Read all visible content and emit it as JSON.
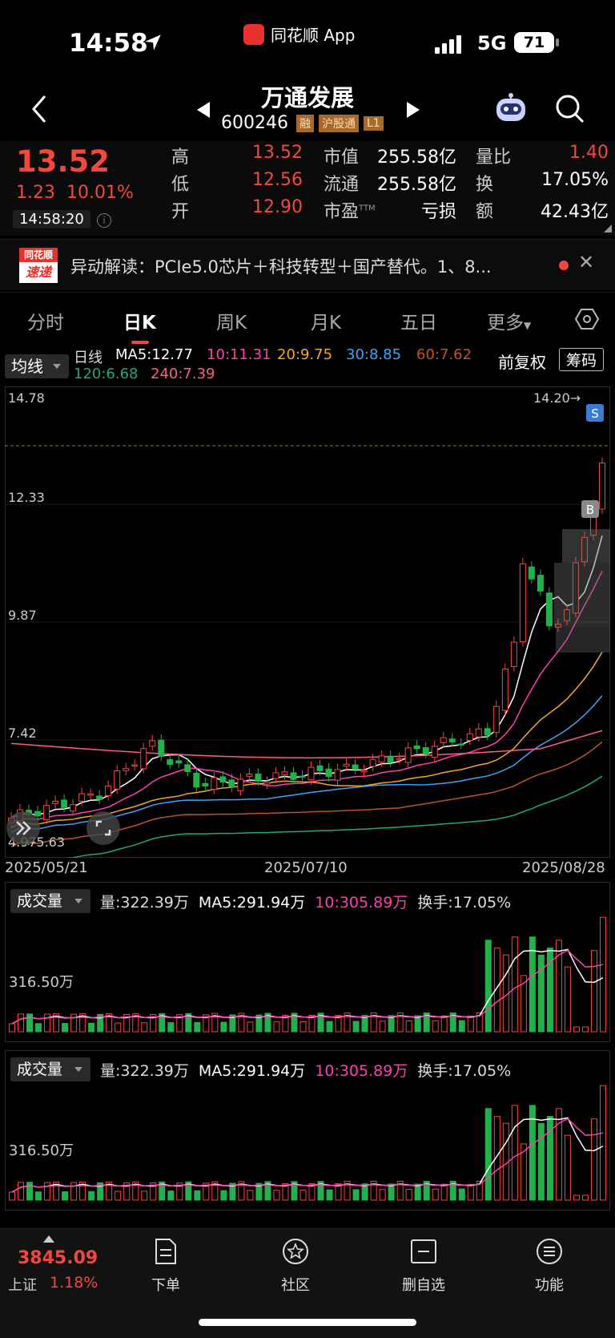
{
  "status_bar": {
    "time": "14:58",
    "app_name": "同花顺 App",
    "network": "5G",
    "battery": "71"
  },
  "header": {
    "stock_name": "万通发展",
    "stock_code": "600246",
    "tags": [
      "融",
      "沪股通",
      "L1"
    ]
  },
  "quote": {
    "price": "13.52",
    "change": "1.23",
    "change_pct": "10.01%",
    "time": "14:58:20",
    "high_label": "高",
    "high": "13.52",
    "low_label": "低",
    "low": "12.56",
    "open_label": "开",
    "open": "12.90",
    "mcap_label": "市值",
    "mcap": "255.58亿",
    "float_label": "流通",
    "float": "255.58亿",
    "pe_label": "市盈",
    "pe_sup": "TTM",
    "pe": "亏损",
    "vr_label": "量比",
    "vr": "1.40",
    "turnover_label": "换",
    "turnover": "17.05%",
    "amount_label": "额",
    "amount": "42.43亿"
  },
  "news": {
    "logo_top": "同花顺",
    "logo_bottom": "速递",
    "text": "异动解读：PCIe5.0芯片＋科技转型＋国产替代。1、8..."
  },
  "tabs": [
    "分时",
    "日K",
    "周K",
    "月K",
    "五日",
    "更多"
  ],
  "ma_bar": {
    "select": "均线",
    "period": "日线",
    "ma5": "MA5:12.77",
    "ma10": "10:11.31",
    "ma20": "20:9.75",
    "ma30": "30:8.85",
    "ma60": "60:7.62",
    "ma120": "120:6.68",
    "ma240": "240:7.39",
    "fuquan": "前复权",
    "chouma": "筹码"
  },
  "kline": {
    "y_labels": [
      "14.78",
      "12.33",
      "9.87",
      "7.42",
      "4.97"
    ],
    "max_mark": "14.20→",
    "min_mark": "←5.63",
    "dates": [
      "2025/05/21",
      "2025/07/10",
      "2025/08/28"
    ],
    "s_marker": "S",
    "b_marker": "B"
  },
  "volume": {
    "select": "成交量",
    "vol": "量:322.39万",
    "ma5": "MA5:291.94万",
    "ma10": "10:305.89万",
    "turnover": "换手:17.05%",
    "axis_label": "316.50万"
  },
  "bottom": {
    "index_value": "3845.09",
    "index_name": "上证",
    "index_pct": "1.18%",
    "nav": [
      "下单",
      "社区",
      "删自选",
      "功能"
    ]
  },
  "colors": {
    "up": "#f2483e",
    "down": "#22b14c",
    "ma5": "#ffffff",
    "ma10": "#ff3fb0",
    "ma20": "#f5a623",
    "ma30": "#3aa6f5",
    "ma60": "#c0522a",
    "ma120": "#1fa87a",
    "ma240": "#ff5f7e"
  }
}
